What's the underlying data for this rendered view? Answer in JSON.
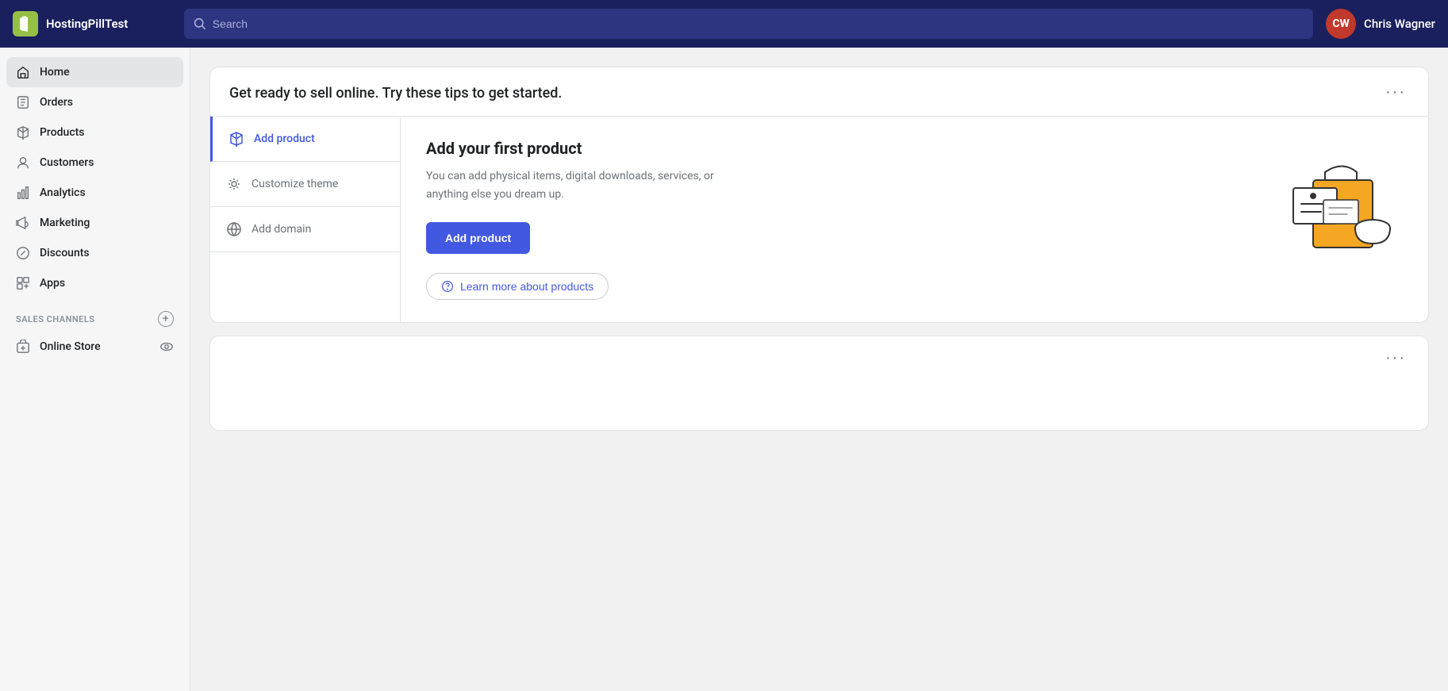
{
  "brand": {
    "logo_text": "S",
    "store_name": "HostingPillTest"
  },
  "topnav": {
    "search_placeholder": "Search"
  },
  "user": {
    "initials": "CW",
    "name": "Chris Wagner"
  },
  "sidebar": {
    "nav_items": [
      {
        "id": "home",
        "label": "Home",
        "icon": "home-icon",
        "active": true
      },
      {
        "id": "orders",
        "label": "Orders",
        "icon": "orders-icon",
        "active": false
      },
      {
        "id": "products",
        "label": "Products",
        "icon": "products-icon",
        "active": false
      },
      {
        "id": "customers",
        "label": "Customers",
        "icon": "customers-icon",
        "active": false
      },
      {
        "id": "analytics",
        "label": "Analytics",
        "icon": "analytics-icon",
        "active": false
      },
      {
        "id": "marketing",
        "label": "Marketing",
        "icon": "marketing-icon",
        "active": false
      },
      {
        "id": "discounts",
        "label": "Discounts",
        "icon": "discounts-icon",
        "active": false
      },
      {
        "id": "apps",
        "label": "Apps",
        "icon": "apps-icon",
        "active": false
      }
    ],
    "sales_channels_label": "SALES CHANNELS",
    "online_store_label": "Online Store"
  },
  "main": {
    "getting_started_title": "Get ready to sell online. Try these tips to get started.",
    "more_options_label": "···",
    "tips": [
      {
        "id": "add-product",
        "label": "Add product",
        "active": true
      },
      {
        "id": "customize-theme",
        "label": "Customize theme",
        "active": false
      },
      {
        "id": "add-domain",
        "label": "Add domain",
        "active": false
      }
    ],
    "active_tip": {
      "title": "Add your first product",
      "description": "You can add physical items, digital downloads, services, or anything else you dream up.",
      "cta_label": "Add product",
      "learn_more_label": "Learn more about products"
    },
    "second_card_more": "···"
  }
}
